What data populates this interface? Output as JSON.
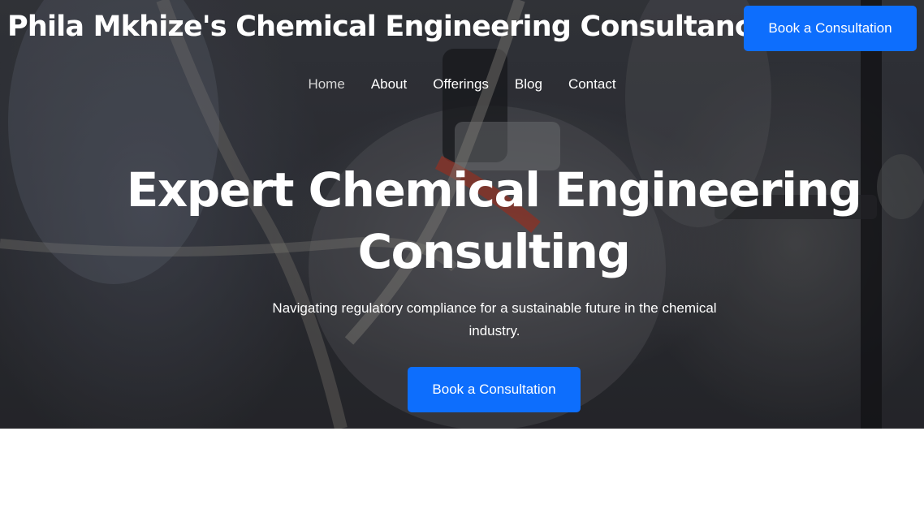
{
  "header": {
    "brand": "Phila Mkhize's Chemical Engineering Consultancy",
    "cta_label": "Book a Consultation"
  },
  "nav": {
    "items": [
      {
        "label": "Home",
        "active": true
      },
      {
        "label": "About"
      },
      {
        "label": "Offerings"
      },
      {
        "label": "Blog"
      },
      {
        "label": "Contact"
      }
    ]
  },
  "hero": {
    "title": "Expert Chemical Engineering Consulting",
    "subtitle": "Navigating regulatory compliance for a sustainable future in the chemical industry.",
    "cta_label": "Book a Consultation",
    "background": "blurred laboratory equipment photo, dark overlay"
  },
  "colors": {
    "accent": "#0d6efd",
    "text": "#ffffff",
    "nav_active": "#d6d6d6"
  }
}
